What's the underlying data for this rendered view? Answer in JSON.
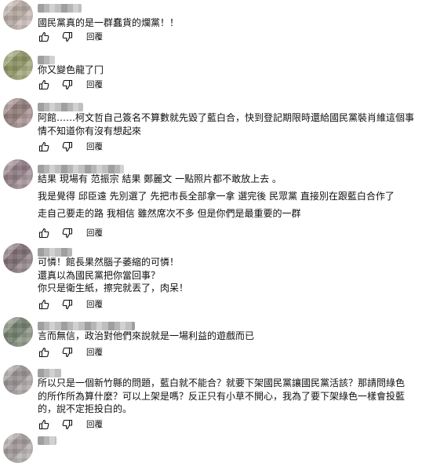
{
  "comments": [
    {
      "lines": [
        "國民黨真的是一群蠢貨的爛黨！！"
      ],
      "reply_label": "回覆",
      "avatar_color": "#c2b4ae"
    },
    {
      "lines": [
        "你又變色龍了冂"
      ],
      "reply_label": "回覆",
      "avatar_color": "#9aa06e"
    },
    {
      "lines": [
        "阿館……柯文哲自己簽名不算數就先毀了藍白合，快到登記期限時還給國民黨裝肖維這個事",
        "情不知道你有沒有想起來"
      ],
      "reply_label": "回覆",
      "avatar_color": "#a08a88"
    },
    {
      "lines": [
        "結果 現場有 范振宗 結果 鄭麗文 一點照片都不敢放上去 。",
        "我是覺得 邱臣遠 先別選了 先把市長全部拿一拿 選完後 民眾黨 直接別在跟藍白合作了",
        "走自己要走的路 我相信 雖然席次不多 但是你們是最重要的一群"
      ],
      "reply_label": "回覆",
      "avatar_color": "#9c8890"
    },
    {
      "lines": [
        "可憐！館長果然腦子萎縮的可憐！",
        "還真以為國民黨把你當回事？",
        "你只是衛生紙，擦完就丟了，肉呆！"
      ],
      "reply_label": "回覆",
      "avatar_color": "#8a7a80"
    },
    {
      "lines": [
        "言而無信，政治對他們來說就是一場利益的遊戲而已"
      ],
      "reply_label": "回覆",
      "avatar_color": "#7f8c78"
    },
    {
      "lines": [
        "所以只是一個新竹縣的問題，藍白就不能合？就要下架國民黨讓國民黨活該？那請問綠色",
        "的所作所為算什麼？可以上架是嗎？反正只有小草不開心，我為了要下架綠色一樣會投藍",
        "的，說不定拒投白的。"
      ],
      "reply_label": "回覆",
      "avatar_color": "#a8a0a0"
    }
  ],
  "icons": {
    "like": "thumbs-up-icon",
    "dislike": "thumbs-down-icon"
  }
}
